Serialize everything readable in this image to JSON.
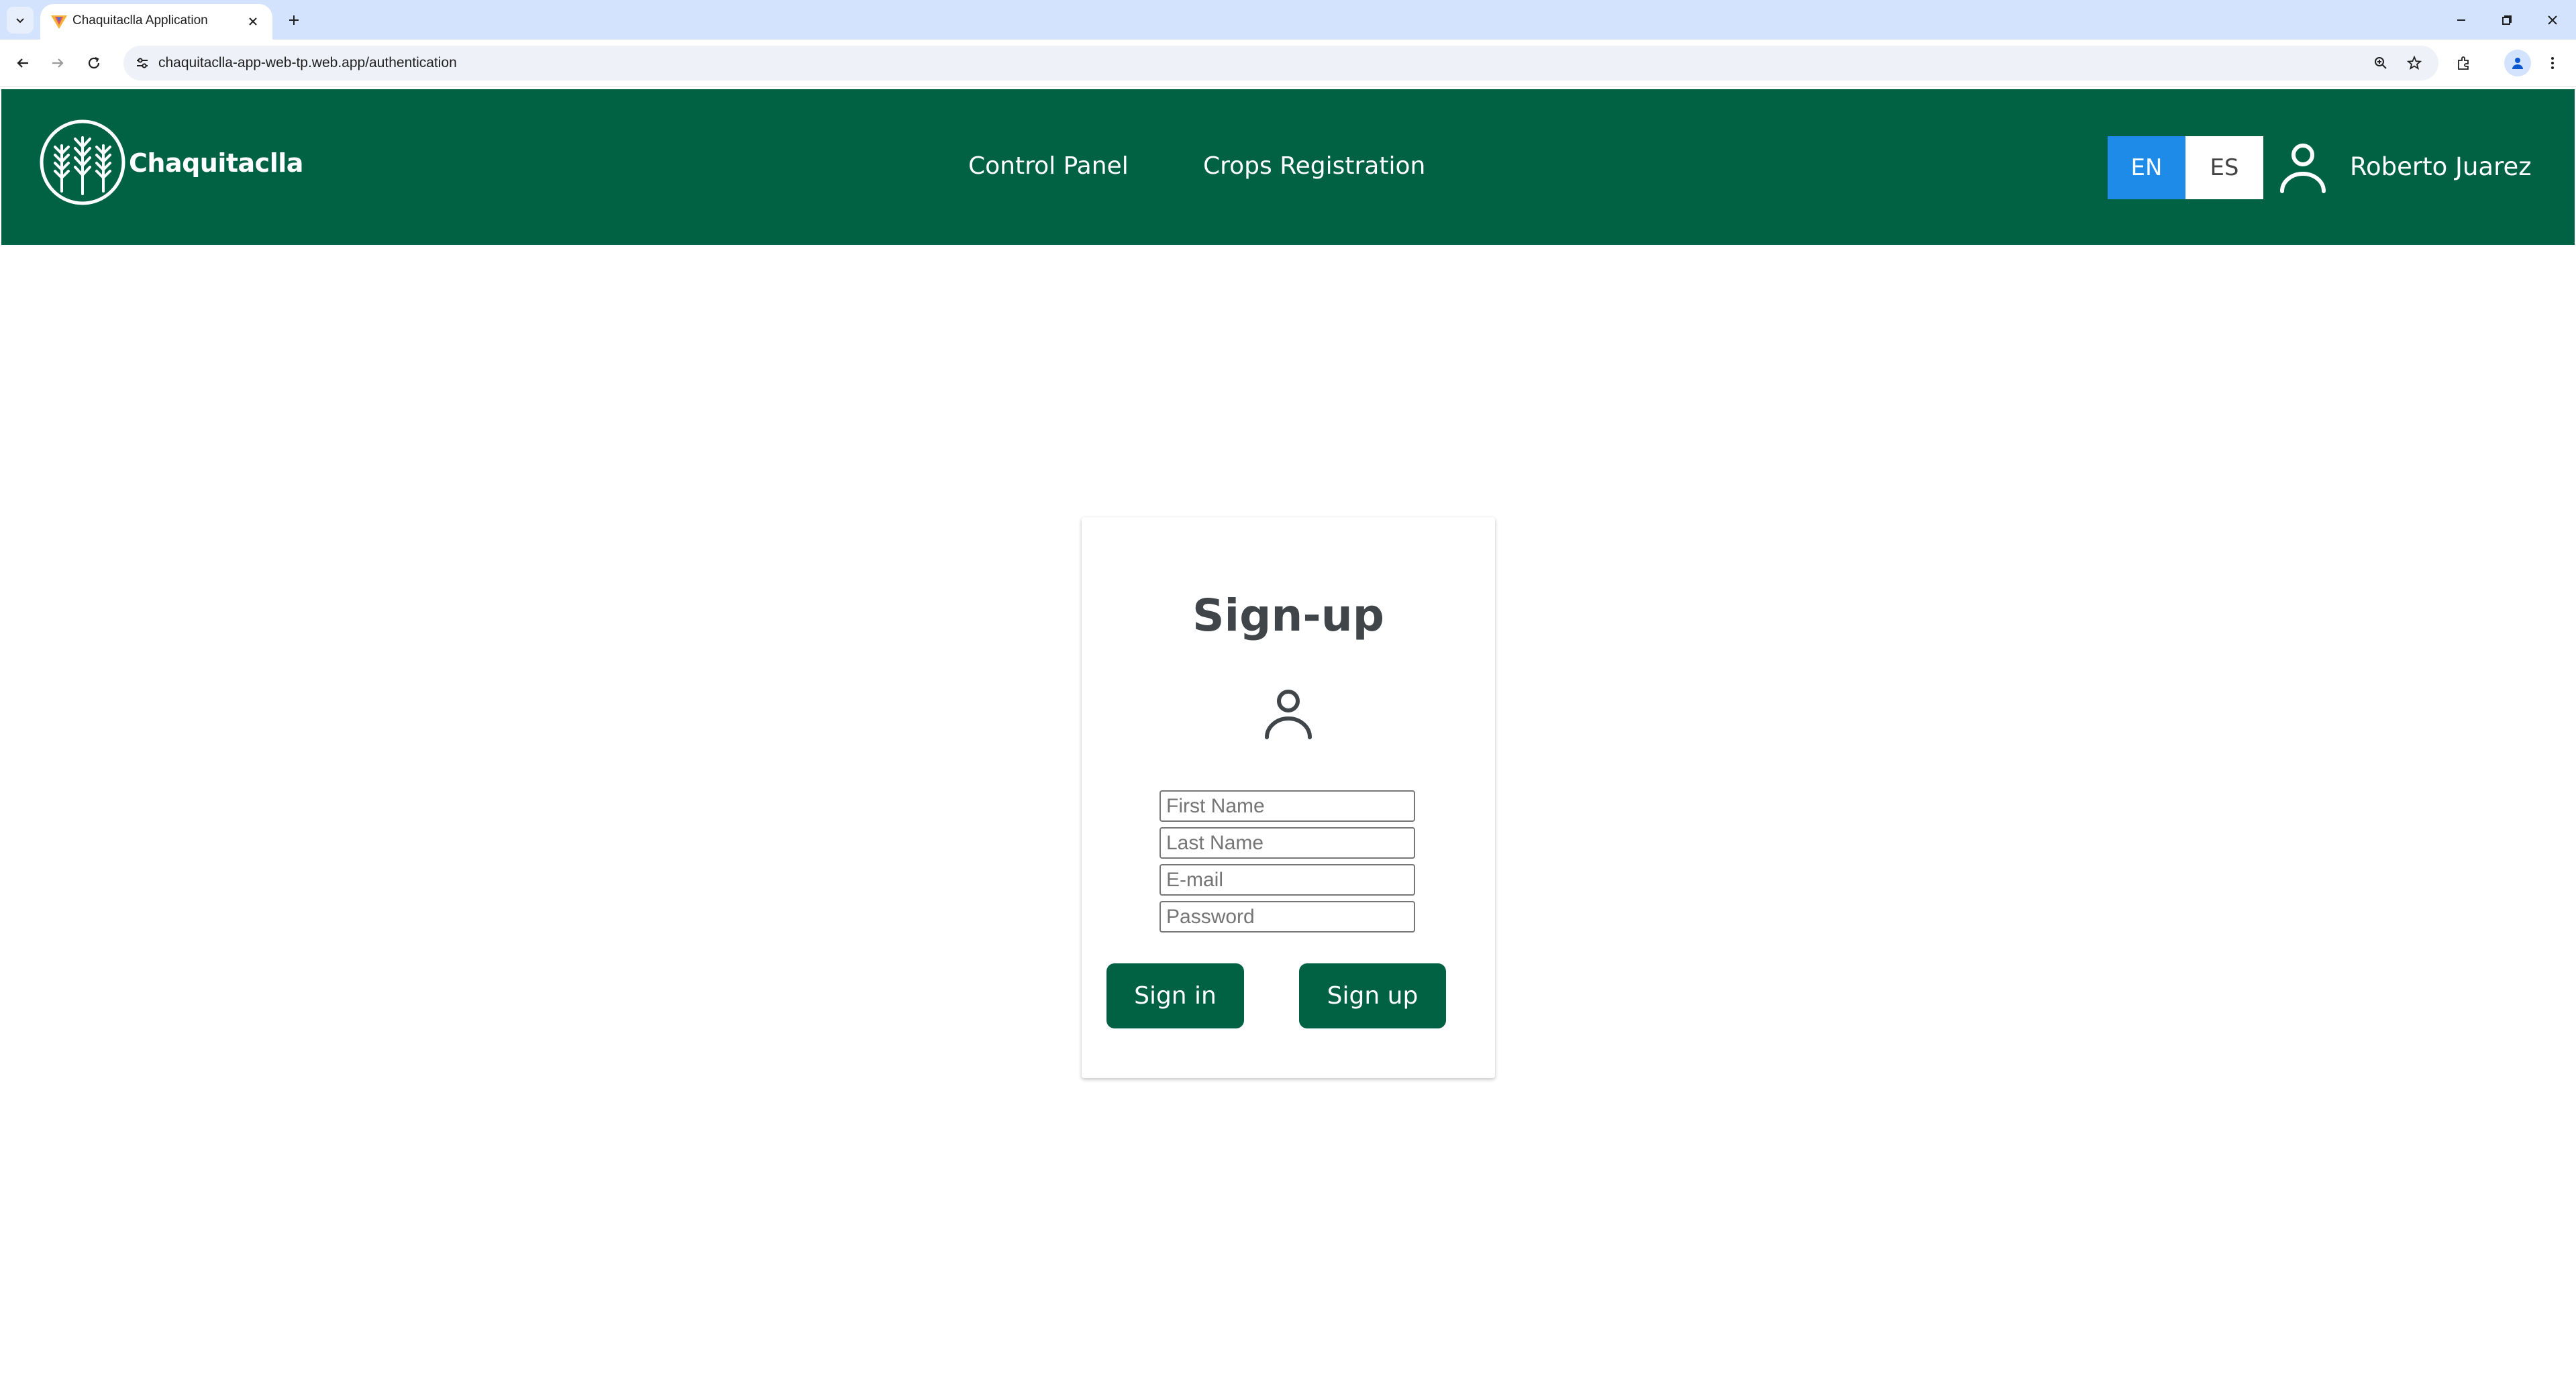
{
  "browser": {
    "tab_title": "Chaquitaclla Application",
    "url": "chaquitaclla-app-web-tp.web.app/authentication"
  },
  "app": {
    "logo_text": "Chaquitaclla",
    "nav": [
      {
        "label": "Control Panel"
      },
      {
        "label": "Crops Registration"
      }
    ],
    "languages": [
      {
        "code": "EN",
        "active": true
      },
      {
        "code": "ES",
        "active": false
      }
    ],
    "user_name": "Roberto Juarez",
    "colors": {
      "header": "#006143",
      "lang_active": "#1e8be8",
      "button": "#006143"
    }
  },
  "signup": {
    "title": "Sign-up",
    "fields": {
      "first_name": {
        "placeholder": "First Name",
        "value": ""
      },
      "last_name": {
        "placeholder": "Last Name",
        "value": ""
      },
      "email": {
        "placeholder": "E-mail",
        "value": ""
      },
      "password": {
        "placeholder": "Password",
        "value": ""
      }
    },
    "sign_in_label": "Sign in",
    "sign_up_label": "Sign up"
  }
}
